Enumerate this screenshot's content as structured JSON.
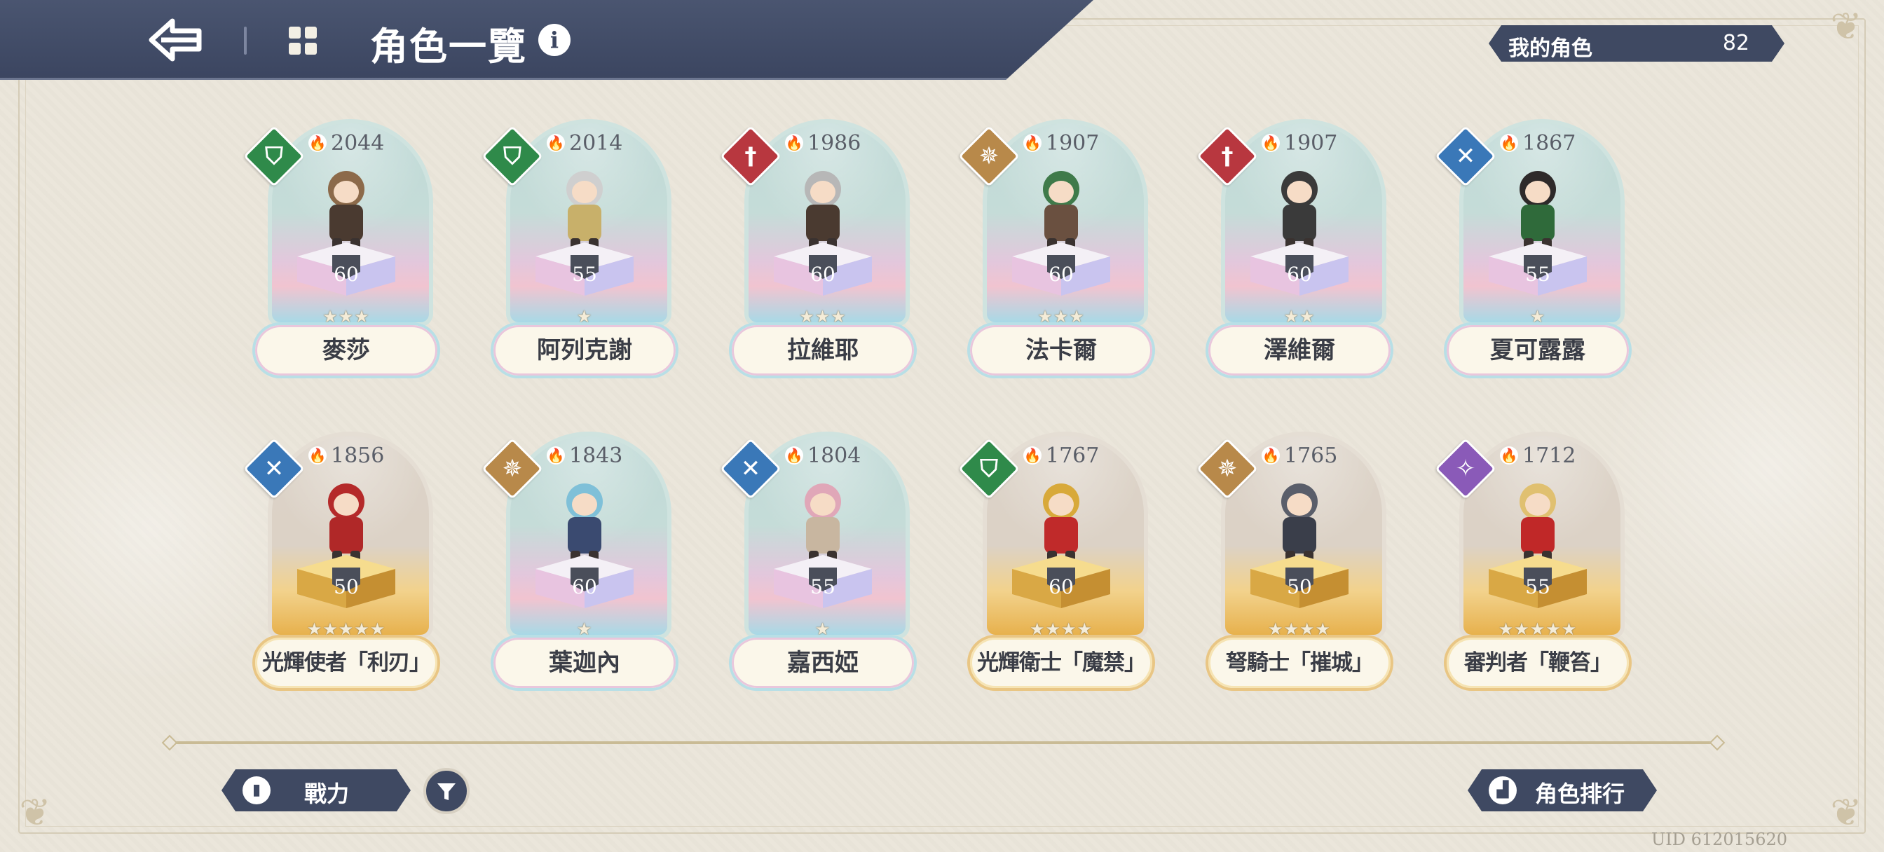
{
  "header": {
    "title": "角色一覽",
    "info_glyph": "i"
  },
  "my_characters": {
    "label": "我的角色",
    "count": "82"
  },
  "characters": [
    {
      "name": "麥莎",
      "power": "2044",
      "level": "60",
      "stars": "★★★",
      "attribute": "shield",
      "attr_color": "#2f8a4a",
      "theme": "blue"
    },
    {
      "name": "阿列克謝",
      "power": "2014",
      "level": "55",
      "stars": "★",
      "attribute": "shield",
      "attr_color": "#2f8a4a",
      "theme": "blue"
    },
    {
      "name": "拉維耶",
      "power": "1986",
      "level": "60",
      "stars": "★★★",
      "attribute": "sword",
      "attr_color": "#b8373f",
      "theme": "blue"
    },
    {
      "name": "法卡爾",
      "power": "1907",
      "level": "60",
      "stars": "★★★",
      "attribute": "compass",
      "attr_color": "#b8894a",
      "theme": "blue"
    },
    {
      "name": "澤維爾",
      "power": "1907",
      "level": "60",
      "stars": "★★",
      "attribute": "sword",
      "attr_color": "#b8373f",
      "theme": "blue"
    },
    {
      "name": "夏可露露",
      "power": "1867",
      "level": "55",
      "stars": "★",
      "attribute": "cross",
      "attr_color": "#3a78b8",
      "theme": "blue"
    },
    {
      "name": "光輝使者「利刃」",
      "power": "1856",
      "level": "50",
      "stars": "★★★★★",
      "attribute": "cross",
      "attr_color": "#3a78b8",
      "theme": "gold"
    },
    {
      "name": "葉迦內",
      "power": "1843",
      "level": "60",
      "stars": "★",
      "attribute": "compass",
      "attr_color": "#b8894a",
      "theme": "blue"
    },
    {
      "name": "嘉西婭",
      "power": "1804",
      "level": "55",
      "stars": "★",
      "attribute": "cross",
      "attr_color": "#3a78b8",
      "theme": "blue"
    },
    {
      "name": "光輝衛士「魔禁」",
      "power": "1767",
      "level": "60",
      "stars": "★★★★",
      "attribute": "shield",
      "attr_color": "#2f8a4a",
      "theme": "gold"
    },
    {
      "name": "弩騎士「摧城」",
      "power": "1765",
      "level": "50",
      "stars": "★★★★",
      "attribute": "compass",
      "attr_color": "#b8894a",
      "theme": "gold"
    },
    {
      "name": "審判者「鞭笞」",
      "power": "1712",
      "level": "55",
      "stars": "★★★★★",
      "attribute": "magic",
      "attr_color": "#8a5ab8",
      "theme": "gold"
    }
  ],
  "bottom": {
    "sort_label": "戰力",
    "ranking_label": "角色排行",
    "uid": "UID 612015620"
  },
  "colors": {
    "header_bg": "#3b4560",
    "page_bg": "#ebe6db",
    "button_bg": "#3f4962"
  }
}
